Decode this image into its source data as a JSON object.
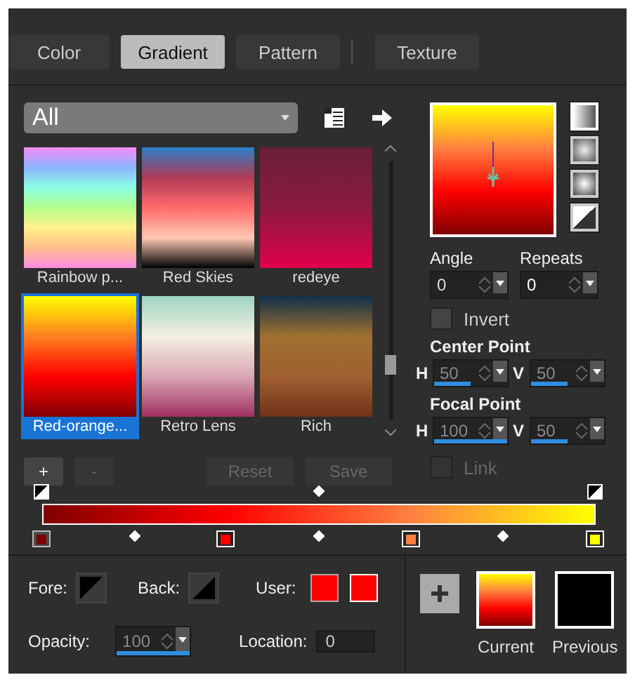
{
  "tabs": [
    {
      "label": "Color",
      "selected": false
    },
    {
      "label": "Gradient",
      "selected": true
    },
    {
      "label": "Pattern",
      "selected": false
    },
    {
      "label": "Texture",
      "selected": false
    }
  ],
  "category": {
    "value": "All"
  },
  "presets": [
    {
      "name": "Rainbow p...",
      "selected": false
    },
    {
      "name": "Red Skies",
      "selected": false
    },
    {
      "name": "redeye",
      "selected": false
    },
    {
      "name": "Red-orange...",
      "selected": true
    },
    {
      "name": "Retro Lens",
      "selected": false
    },
    {
      "name": "Rich",
      "selected": false
    }
  ],
  "preset_buttons": [
    {
      "label": "+",
      "disabled": false
    },
    {
      "label": "-",
      "disabled": true
    },
    {
      "label": "Reset",
      "disabled": true
    },
    {
      "label": "Save",
      "disabled": true
    }
  ],
  "styles": [
    {
      "kind": "linear",
      "selected": true
    },
    {
      "kind": "rectangular",
      "selected": false
    },
    {
      "kind": "radial",
      "selected": false
    },
    {
      "kind": "sunburst",
      "selected": false
    }
  ],
  "angle": {
    "label": "Angle",
    "value": "0"
  },
  "repeats": {
    "label": "Repeats",
    "value": "0"
  },
  "invert": {
    "label": "Invert",
    "checked": false,
    "disabled": false
  },
  "center_point": {
    "label": "Center Point",
    "h": {
      "label": "H",
      "value": "50",
      "level": 0.5
    },
    "v": {
      "label": "V",
      "value": "50",
      "level": 0.5
    }
  },
  "focal_point": {
    "label": "Focal Point",
    "h": {
      "label": "H",
      "value": "100",
      "level": 1
    },
    "v": {
      "label": "V",
      "value": "50",
      "level": 0.5
    }
  },
  "link": {
    "label": "Link",
    "checked": false,
    "disabled": true
  },
  "color_stops": [
    {
      "color": "#800000",
      "selected": true
    },
    {
      "color": "#ff0000",
      "selected": false
    },
    {
      "color": "#ff8040",
      "selected": false
    },
    {
      "color": "#ffff00",
      "selected": false
    }
  ],
  "fore": {
    "label": "Fore:"
  },
  "back": {
    "label": "Back:"
  },
  "user": {
    "label": "User:",
    "colors": [
      {
        "color": "#ff0000"
      },
      {
        "color": "#ff0000"
      }
    ]
  },
  "opacity": {
    "label": "Opacity:",
    "value": "100",
    "level": 1
  },
  "location": {
    "label": "Location:",
    "value": "0"
  },
  "current": {
    "label": "Current"
  },
  "previous": {
    "label": "Previous",
    "color": "#000000"
  }
}
